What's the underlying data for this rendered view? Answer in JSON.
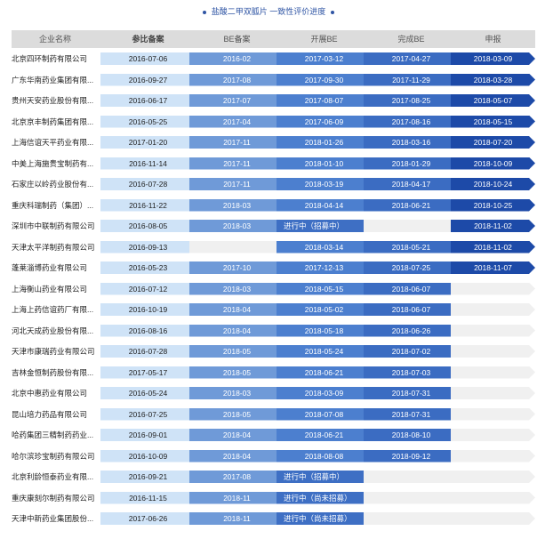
{
  "title": "盐酸二甲双胍片 一致性评价进度",
  "columns": [
    "企业名称",
    "参比备案",
    "BE备案",
    "开展BE",
    "完成BE",
    "申报"
  ],
  "rows": [
    {
      "name": "北京四环制药有限公司",
      "cells": [
        "2016-07-06",
        "2016-02",
        "2017-03-12",
        "2017-04-27",
        "2018-03-09"
      ]
    },
    {
      "name": "广东华南药业集团有限...",
      "cells": [
        "2016-09-27",
        "2017-08",
        "2017-09-30",
        "2017-11-29",
        "2018-03-28"
      ]
    },
    {
      "name": "贵州天安药业股份有限...",
      "cells": [
        "2016-06-17",
        "2017-07",
        "2017-08-07",
        "2017-08-25",
        "2018-05-07"
      ]
    },
    {
      "name": "北京京丰制药集团有限...",
      "cells": [
        "2016-05-25",
        "2017-04",
        "2017-06-09",
        "2017-08-16",
        "2018-05-15"
      ]
    },
    {
      "name": "上海信谊天平药业有限...",
      "cells": [
        "2017-01-20",
        "2017-11",
        "2018-01-26",
        "2018-03-16",
        "2018-07-20"
      ]
    },
    {
      "name": "中美上海施贵宝制药有...",
      "cells": [
        "2016-11-14",
        "2017-11",
        "2018-01-10",
        "2018-01-29",
        "2018-10-09"
      ]
    },
    {
      "name": "石家庄以岭药业股份有...",
      "cells": [
        "2016-07-28",
        "2017-11",
        "2018-03-19",
        "2018-04-17",
        "2018-10-24"
      ]
    },
    {
      "name": "重庆科瑞制药（集团）...",
      "cells": [
        "2016-11-22",
        "2018-03",
        "2018-04-14",
        "2018-06-21",
        "2018-10-25"
      ]
    },
    {
      "name": "深圳市中联制药有限公司",
      "cells": [
        "2016-08-05",
        "2018-03",
        "进行中（招募中）",
        "",
        "2018-11-02"
      ]
    },
    {
      "name": "天津太平洋制药有限公司",
      "cells": [
        "2016-09-13",
        "",
        "2018-03-14",
        "2018-05-21",
        "2018-11-02"
      ]
    },
    {
      "name": "蓬莱淄博药业有限公司",
      "cells": [
        "2016-05-23",
        "2017-10",
        "2017-12-13",
        "2018-07-25",
        "2018-11-07"
      ]
    },
    {
      "name": "上海衡山药业有限公司",
      "cells": [
        "2016-07-12",
        "2018-03",
        "2018-05-15",
        "2018-06-07",
        ""
      ]
    },
    {
      "name": "上海上药信谊药厂有限...",
      "cells": [
        "2016-10-19",
        "2018-04",
        "2018-05-02",
        "2018-06-07",
        ""
      ]
    },
    {
      "name": "河北天成药业股份有限...",
      "cells": [
        "2016-08-16",
        "2018-04",
        "2018-05-18",
        "2018-06-26",
        ""
      ]
    },
    {
      "name": "天津市康瑞药业有限公司",
      "cells": [
        "2016-07-28",
        "2018-05",
        "2018-05-24",
        "2018-07-02",
        ""
      ]
    },
    {
      "name": "吉林金恒制药股份有限...",
      "cells": [
        "2017-05-17",
        "2018-05",
        "2018-06-21",
        "2018-07-03",
        ""
      ]
    },
    {
      "name": "北京中惠药业有限公司",
      "cells": [
        "2016-05-24",
        "2018-03",
        "2018-03-09",
        "2018-07-31",
        ""
      ]
    },
    {
      "name": "昆山培力药品有限公司",
      "cells": [
        "2016-07-25",
        "2018-05",
        "2018-07-08",
        "2018-07-31",
        ""
      ]
    },
    {
      "name": "哈药集团三精制药药业...",
      "cells": [
        "2016-09-01",
        "2018-04",
        "2018-06-21",
        "2018-08-10",
        ""
      ]
    },
    {
      "name": "哈尔滨珍宝制药有限公司",
      "cells": [
        "2016-10-09",
        "2018-04",
        "2018-08-08",
        "2018-09-12",
        ""
      ]
    },
    {
      "name": "北京利龄恒泰药业有限...",
      "cells": [
        "2016-09-21",
        "2017-08",
        "进行中（招募中）",
        "",
        ""
      ]
    },
    {
      "name": "重庆康刻尔制药有限公司",
      "cells": [
        "2016-11-15",
        "2018-11",
        "进行中（尚未招募）",
        "",
        ""
      ]
    },
    {
      "name": "天津中新药业集团股份...",
      "cells": [
        "2017-06-26",
        "2018-11",
        "进行中（尚未招募）",
        "",
        ""
      ]
    }
  ]
}
